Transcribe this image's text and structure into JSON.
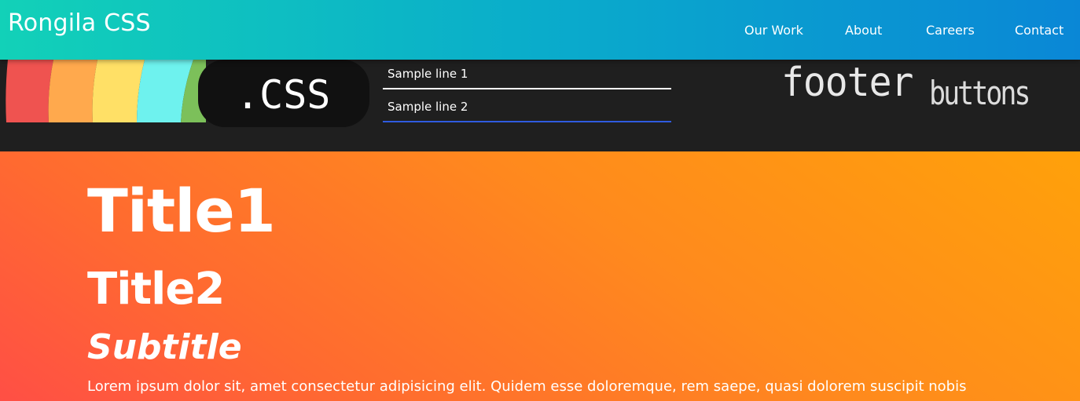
{
  "navbar": {
    "brand": "Rongila CSS",
    "links": [
      "Our Work",
      "About",
      "Careers",
      "Contact"
    ],
    "gradient_colors": [
      "#12d1b8",
      "#0a87d6"
    ]
  },
  "banner": {
    "logo_text": ".CSS",
    "rainbow_colors": [
      "#ef5350",
      "#ffa94d",
      "#ffe066",
      "#6ef2ee",
      "#7cc05a"
    ],
    "inputs": [
      {
        "value": "Sample line 1",
        "underline_color": "#ffffff"
      },
      {
        "value": "Sample line 2",
        "underline_color": "#2f5be0"
      }
    ],
    "sprite_words": [
      "footer",
      "buttons"
    ]
  },
  "hero": {
    "title1": "Title1",
    "title2": "Title2",
    "subtitle": "Subtitle",
    "paragraph": "Lorem ipsum dolor sit, amet consectetur adipisicing elit. Quidem esse doloremque, rem saepe, quasi dolorem suscipit nobis",
    "gradient_colors": [
      "#ff4f45",
      "#ffa10a"
    ]
  }
}
